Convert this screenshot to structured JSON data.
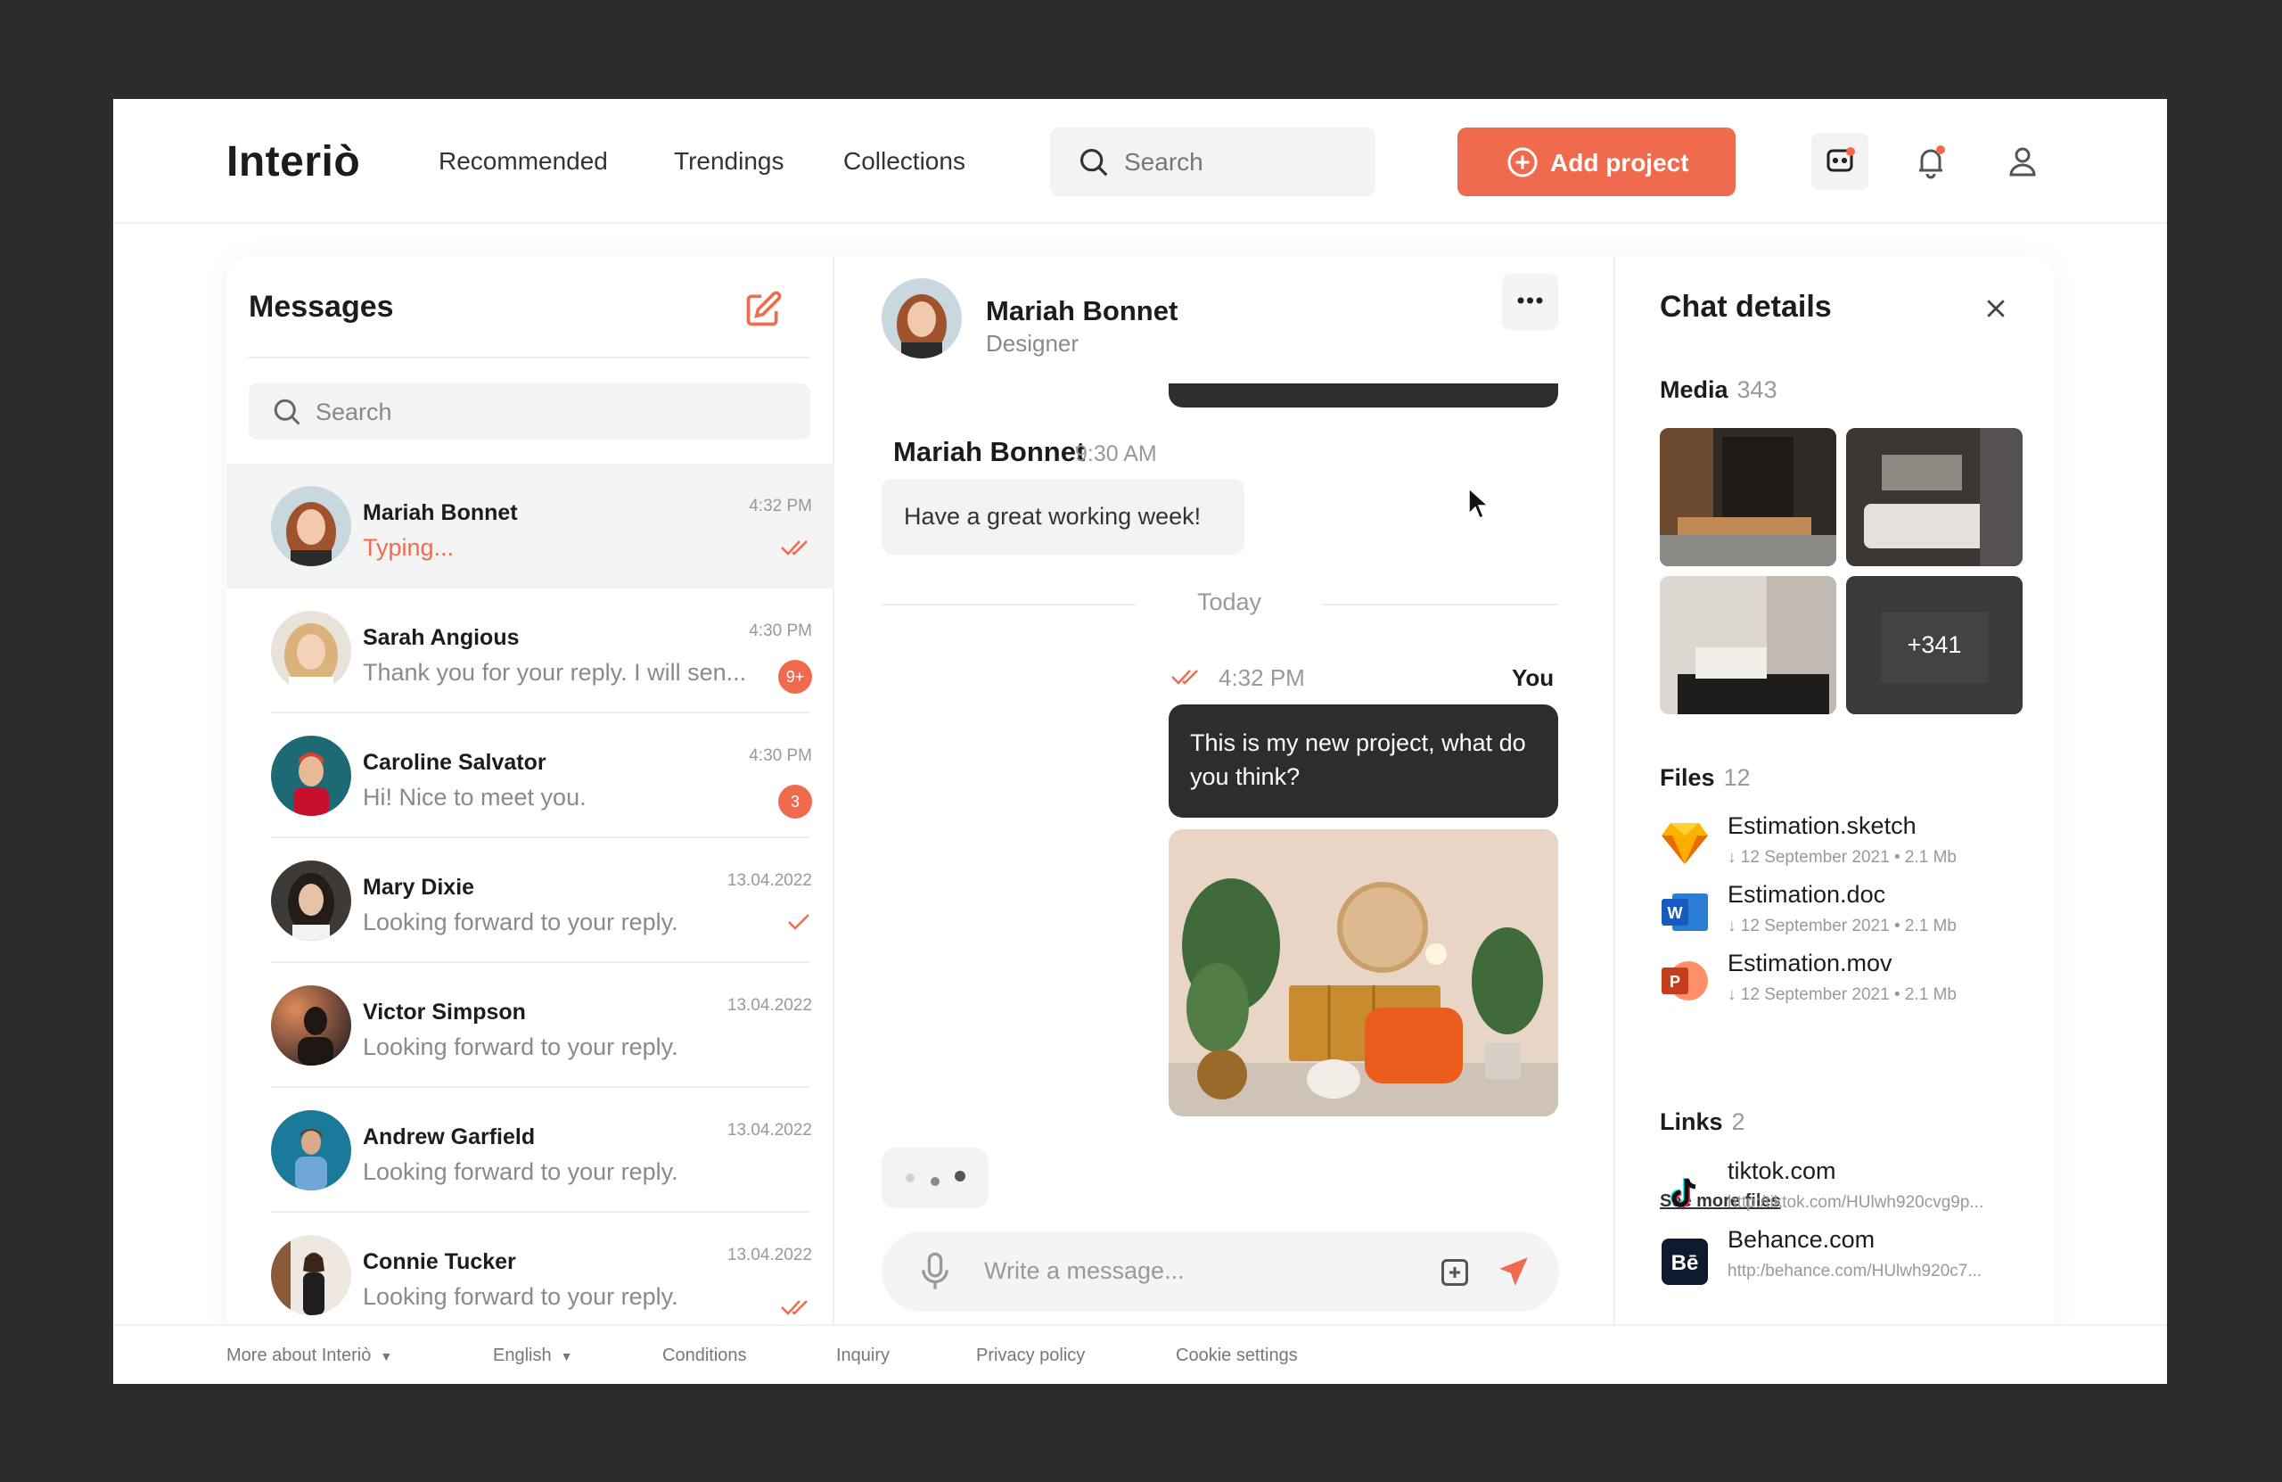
{
  "brand": "Interiò",
  "nav": {
    "links": [
      "Recommended",
      "Trendings",
      "Collections"
    ],
    "search_placeholder": "Search",
    "add_project": "Add project"
  },
  "colors": {
    "accent": "#f06b4e",
    "dark_bubble": "#2d2d2f",
    "muted": "#999999"
  },
  "messages": {
    "title": "Messages",
    "search_placeholder": "Search",
    "conversations": [
      {
        "name": "Mariah Bonnet",
        "preview": "Typing...",
        "time": "4:32 PM",
        "status": "double-tick",
        "active": true,
        "typing": true
      },
      {
        "name": "Sarah Angious",
        "preview": "Thank you for your reply. I will sen...",
        "time": "4:30 PM",
        "badge": "9+"
      },
      {
        "name": "Caroline Salvator",
        "preview": "Hi! Nice to meet you.",
        "time": "4:30 PM",
        "badge": "3"
      },
      {
        "name": "Mary Dixie",
        "preview": "Looking forward to your reply.",
        "time": "13.04.2022",
        "status": "tick"
      },
      {
        "name": "Victor Simpson",
        "preview": "Looking forward to your reply.",
        "time": "13.04.2022"
      },
      {
        "name": "Andrew Garfield",
        "preview": "Looking forward to your reply.",
        "time": "13.04.2022"
      },
      {
        "name": "Connie Tucker",
        "preview": "Looking forward to your reply.",
        "time": "13.04.2022",
        "status": "double-tick"
      }
    ]
  },
  "chat": {
    "contact_name": "Mariah Bonnet",
    "contact_role": "Designer",
    "incoming_sender": "Mariah Bonnet",
    "incoming_time": "9:30 AM",
    "incoming_text": "Have a great working week!",
    "divider_label": "Today",
    "outgoing_time": "4:32 PM",
    "outgoing_sender": "You",
    "outgoing_text": "This is my new project, what do you think?",
    "composer_placeholder": "Write a message..."
  },
  "details": {
    "title": "Chat details",
    "media_label": "Media",
    "media_count": "343",
    "media_more": "+341",
    "files_label": "Files",
    "files_count": "12",
    "files": [
      {
        "name": "Estimation.sketch",
        "meta": "12 September 2021 • 2.1 Mb",
        "icon": "sketch-icon"
      },
      {
        "name": "Estimation.doc",
        "meta": "12 September 2021 • 2.1 Mb",
        "icon": "word-icon"
      },
      {
        "name": "Estimation.mov",
        "meta": "12 September 2021 • 2.1 Mb",
        "icon": "powerpoint-icon"
      }
    ],
    "see_more": "See more files",
    "links_label": "Links",
    "links_count": "2",
    "links": [
      {
        "name": "tiktok.com",
        "url": "http:/tiktok.com/HUlwh920cvg9p...",
        "icon": "tiktok-icon"
      },
      {
        "name": "Behance.com",
        "url": "http:/behance.com/HUlwh920c7...",
        "icon": "behance-icon"
      }
    ]
  },
  "footer": {
    "items": [
      "More about Interiò",
      "English",
      "Conditions",
      "Inquiry",
      "Privacy policy",
      "Cookie settings"
    ]
  }
}
